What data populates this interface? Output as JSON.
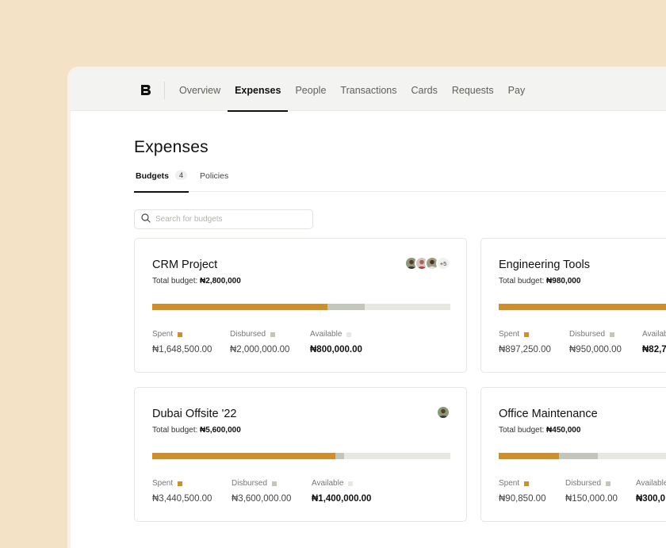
{
  "nav": {
    "items": [
      "Overview",
      "Expenses",
      "People",
      "Transactions",
      "Cards",
      "Requests",
      "Pay"
    ],
    "active": "Expenses"
  },
  "page": {
    "title": "Expenses"
  },
  "tabs": [
    {
      "label": "Budgets",
      "count": "4"
    },
    {
      "label": "Policies"
    }
  ],
  "search": {
    "placeholder": "Search for budgets"
  },
  "stat_labels": {
    "spent": "Spent",
    "disbursed": "Disbursed",
    "available": "Available"
  },
  "total_label": "Total budget:",
  "colors": {
    "spent": "#d08d2c",
    "disbursed": "#c3c7bb",
    "available": "#e8e8e3"
  },
  "budgets": [
    {
      "name": "CRM Project",
      "total": "₦2,800,000",
      "spent": "₦1,648,500.00",
      "disbursed": "₦2,000,000.00",
      "available": "₦800,000.00",
      "spent_fraction": 0.589,
      "disbursed_fraction": 0.714,
      "avatars": [
        "avatar-1",
        "avatar-2",
        "avatar-3"
      ],
      "extra_members": "+5"
    },
    {
      "name": "Engineering Tools",
      "total": "₦980,000",
      "spent": "₦897,250.00",
      "disbursed": "₦950,000.00",
      "available": "₦82,7",
      "spent_fraction": 0.916,
      "disbursed_fraction": 0.969
    },
    {
      "name": "Dubai Offsite '22",
      "total": "₦5,600,000",
      "spent": "₦3,440,500.00",
      "disbursed": "₦3,600,000.00",
      "available": "₦1,400,000.00",
      "spent_fraction": 0.614,
      "disbursed_fraction": 0.643,
      "avatars": [
        "avatar-1"
      ]
    },
    {
      "name": "Office Maintenance",
      "total": "₦450,000",
      "spent": "₦90,850.00",
      "disbursed": "₦150,000.00",
      "available": "₦300,0",
      "spent_fraction": 0.202,
      "disbursed_fraction": 0.333
    }
  ]
}
